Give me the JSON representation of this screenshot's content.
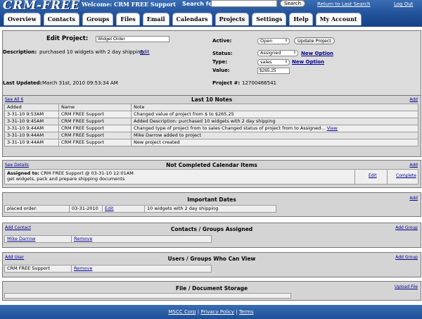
{
  "header": {
    "logo": "CRM-FREE",
    "welcome": "Welcome: CRM FREE Support",
    "search_label": "Search for:",
    "search_value": "",
    "search_button": "Search",
    "return_link": "Return to Last Search",
    "logout_link": "Log Out"
  },
  "tabs": [
    {
      "label": "Overview"
    },
    {
      "label": "Contacts"
    },
    {
      "label": "Groups"
    },
    {
      "label": "Files"
    },
    {
      "label": "Email"
    },
    {
      "label": "Calendars"
    },
    {
      "label": "Projects"
    },
    {
      "label": "Settings"
    },
    {
      "label": "Help"
    },
    {
      "label": "My Account"
    }
  ],
  "project": {
    "edit_label": "Edit Project:",
    "name_value": "Widget Order",
    "description_label": "Description:",
    "description": "purchased 10 widgets with 2 day shipping",
    "description_edit": "Edit",
    "last_updated_label": "Last Updated:",
    "last_updated": "March 31st, 2010 09:53:34 AM",
    "active_label": "Active:",
    "active_value": "Open",
    "update_button": "Update Project",
    "status_label": "Status:",
    "status_value": "Assigned",
    "type_label": "Type:",
    "type_value": "sales",
    "new_option": "New Option",
    "value_label": "Value:",
    "value": "$265.25",
    "project_num_label": "Project #:",
    "project_num": "12700466541"
  },
  "notes": {
    "title": "Last 10 Notes",
    "see_all": "See All 6",
    "add": "Add",
    "columns": [
      "Added",
      "Name",
      "Note"
    ],
    "rows": [
      {
        "added": "3-31-10 9:53AM",
        "name": "CRM FREE Support",
        "note": "Changed value of project from $ to $265.25",
        "view": ""
      },
      {
        "added": "3-31-10 9:45AM",
        "name": "CRM FREE Support",
        "note": "Added Description: purchased 10 widgets with 2 day shipping",
        "view": ""
      },
      {
        "added": "3-31-10 9:44AM",
        "name": "CRM FREE Support",
        "note": "Changed type of project from to sales Changed status of project from to Assigned...",
        "view": "View"
      },
      {
        "added": "3-31-10 9:44AM",
        "name": "CRM FREE Support",
        "note": "Mike Darrow added to project",
        "view": ""
      },
      {
        "added": "3-31-10 9:44AM",
        "name": "CRM FREE Support",
        "note": "New project created",
        "view": ""
      }
    ]
  },
  "calendar": {
    "title": "Not Completed Calendar Items",
    "see_details": "See Details",
    "add": "Add",
    "assigned_label": "Assigned to:",
    "assigned_text": "CRM FREE Support @ 03-31-10 12:01AM",
    "description": "get widgets, pack and prepare shipping documents",
    "edit": "Edit",
    "complete": "Complete"
  },
  "dates": {
    "title": "Important Dates",
    "add": "Add",
    "label": "placed order:",
    "date": "03-31-2010",
    "edit": "Edit",
    "note": "10 widgets with 2 day shipping"
  },
  "contacts": {
    "title": "Contacts / Groups Assigned",
    "add_contact": "Add Contact",
    "add_group": "Add Group",
    "name": "Mike Darrow",
    "remove": "Remove"
  },
  "users": {
    "title": "Users / Groups Who Can View",
    "add_user": "Add User",
    "add_group": "Add Group",
    "name": "CRM FREE Support",
    "remove": "Remove"
  },
  "files": {
    "title": "File / Document Storage",
    "upload": "Upload File"
  },
  "footer": {
    "link1": "MSCC Corp",
    "link2": "Privacy Policy",
    "link3": "Terms",
    "sep": "|"
  },
  "colors": {
    "header_blue": "#1f4f96",
    "panel_gray": "#d4d4d4",
    "link_blue": "#00008b"
  }
}
